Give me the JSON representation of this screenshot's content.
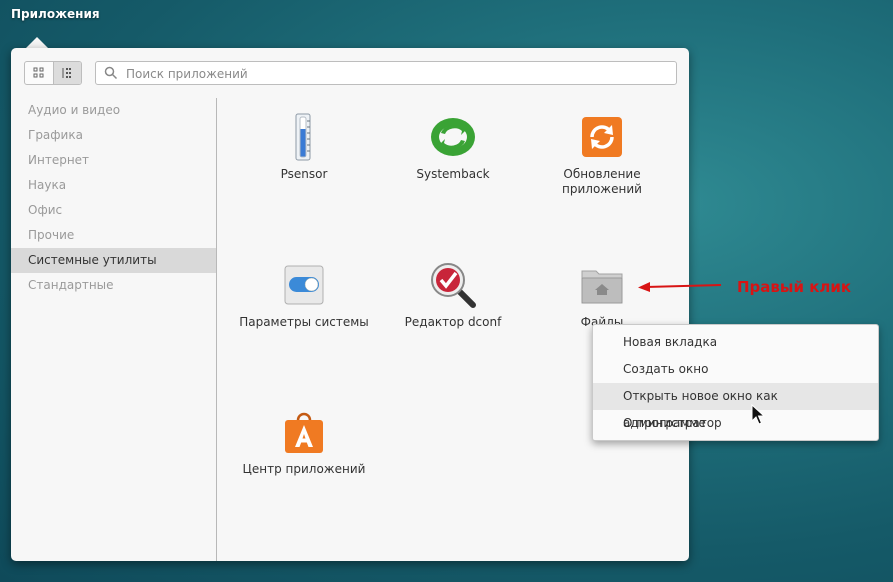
{
  "topbar": {
    "apps_label": "Приложения"
  },
  "search": {
    "placeholder": "Поиск приложений"
  },
  "categories": [
    {
      "label": "Аудио и видео"
    },
    {
      "label": "Графика"
    },
    {
      "label": "Интернет"
    },
    {
      "label": "Наука"
    },
    {
      "label": "Офис"
    },
    {
      "label": "Прочие"
    },
    {
      "label": "Системные утилиты",
      "selected": true
    },
    {
      "label": "Стандартные"
    }
  ],
  "apps": [
    {
      "label": "Psensor",
      "icon": "thermometer-icon"
    },
    {
      "label": "Systemback",
      "icon": "green-recycle-icon"
    },
    {
      "label": "Обновление приложений",
      "icon": "orange-update-icon"
    },
    {
      "label": "Параметры системы",
      "icon": "toggle-switch-icon"
    },
    {
      "label": "Редактор dconf",
      "icon": "magnifier-check-icon"
    },
    {
      "label": "Файлы",
      "icon": "home-folder-icon"
    },
    {
      "label": "Центр приложений",
      "icon": "shopping-bag-icon"
    }
  ],
  "context_menu": {
    "items": [
      {
        "label": "Новая вкладка"
      },
      {
        "label": "Создать окно"
      },
      {
        "label": "Открыть новое окно как администратор",
        "hovered": true
      },
      {
        "label": "О программе"
      }
    ]
  },
  "annotation": {
    "text": "Правый клик",
    "color": "#d81414"
  },
  "colors": {
    "selected_category_bg": "#d9d9d9",
    "desktop": "#1f6f7b"
  }
}
